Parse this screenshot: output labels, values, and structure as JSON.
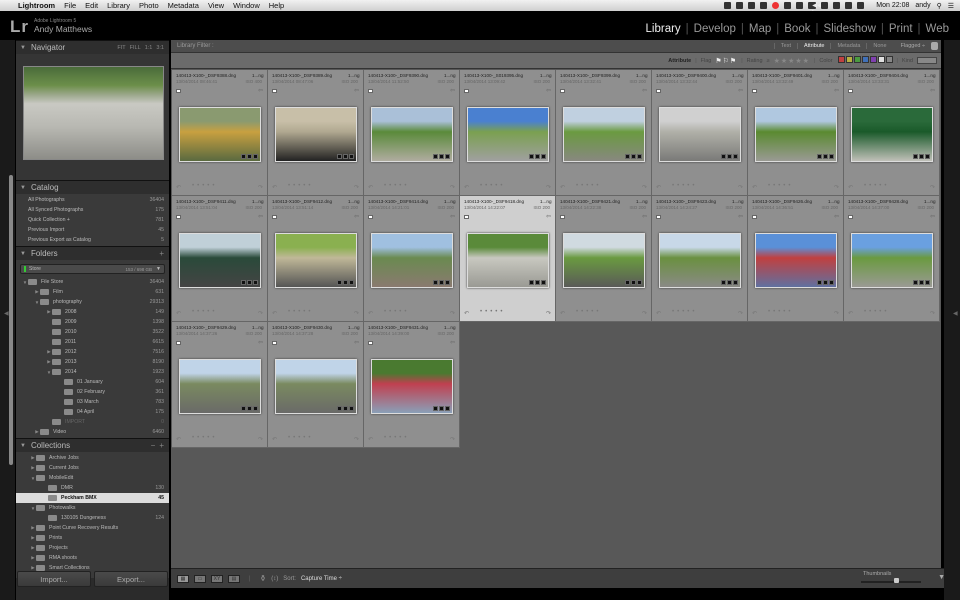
{
  "menubar": {
    "apple": "",
    "app_name": "Lightroom",
    "items": [
      "File",
      "Edit",
      "Library",
      "Photo",
      "Metadata",
      "View",
      "Window",
      "Help"
    ],
    "clock": "Mon 22:08",
    "user": "andy"
  },
  "header": {
    "logo": "Lr",
    "product": "Adobe Lightroom 5",
    "user_name": "Andy Matthews",
    "modules": [
      {
        "label": "Library",
        "active": true
      },
      {
        "label": "Develop"
      },
      {
        "label": "Map"
      },
      {
        "label": "Book"
      },
      {
        "label": "Slideshow"
      },
      {
        "label": "Print"
      },
      {
        "label": "Web"
      }
    ]
  },
  "left": {
    "navigator": {
      "title": "Navigator",
      "zoom_opts": [
        "FIT",
        "FILL",
        "1:1",
        "3:1"
      ]
    },
    "catalog": {
      "title": "Catalog",
      "items": [
        {
          "label": "All Photographs",
          "count": "36404"
        },
        {
          "label": "All Synced Photographs",
          "count": "175"
        },
        {
          "label": "Quick Collection +",
          "count": "781"
        },
        {
          "label": "Previous Import",
          "count": "45"
        },
        {
          "label": "Previous Export as Catalog",
          "count": "5"
        }
      ]
    },
    "folders": {
      "title": "Folders",
      "add": "+",
      "volume": {
        "name": "Store",
        "capacity": "153 / 698 GB"
      },
      "items": [
        {
          "label": "File Store",
          "count": "36404",
          "level": 0,
          "tw": "▼"
        },
        {
          "label": "Film",
          "count": "631",
          "level": 1,
          "tw": "▶"
        },
        {
          "label": "photography",
          "count": "29313",
          "level": 1,
          "tw": "▼"
        },
        {
          "label": "2008",
          "count": "149",
          "level": 2,
          "tw": "▶"
        },
        {
          "label": "2009",
          "count": "1398",
          "level": 2,
          "tw": ""
        },
        {
          "label": "2010",
          "count": "3522",
          "level": 2,
          "tw": ""
        },
        {
          "label": "2011",
          "count": "6615",
          "level": 2,
          "tw": ""
        },
        {
          "label": "2012",
          "count": "7516",
          "level": 2,
          "tw": "▶"
        },
        {
          "label": "2013",
          "count": "8190",
          "level": 2,
          "tw": "▶"
        },
        {
          "label": "2014",
          "count": "1923",
          "level": 2,
          "tw": "▼"
        },
        {
          "label": "01 January",
          "count": "604",
          "level": 3,
          "tw": ""
        },
        {
          "label": "02 February",
          "count": "361",
          "level": 3,
          "tw": ""
        },
        {
          "label": "03 March",
          "count": "783",
          "level": 3,
          "tw": ""
        },
        {
          "label": "04 April",
          "count": "175",
          "level": 3,
          "tw": ""
        },
        {
          "label": "IMPORT",
          "count": "0",
          "level": 2,
          "tw": "",
          "dim": true
        },
        {
          "label": "Video",
          "count": "6460",
          "level": 1,
          "tw": "▶"
        }
      ]
    },
    "collections": {
      "title": "Collections",
      "minus": "−",
      "add": "+",
      "items": [
        {
          "label": "Archive Jobs",
          "count": "",
          "level": 0,
          "tw": "▶"
        },
        {
          "label": "Current Jobs",
          "count": "",
          "level": 0,
          "tw": "▶"
        },
        {
          "label": "MobileEdit",
          "count": "",
          "level": 0,
          "tw": "▼"
        },
        {
          "label": "DMR",
          "count": "130",
          "level": 1,
          "tw": ""
        },
        {
          "label": "Peckham BMX",
          "count": "45",
          "level": 1,
          "tw": "",
          "selected": true
        },
        {
          "label": "Photowalks",
          "count": "",
          "level": 0,
          "tw": "▼"
        },
        {
          "label": "130105 Dungeness",
          "count": "124",
          "level": 1,
          "tw": ""
        },
        {
          "label": "Point Curve Recovery Results",
          "count": "",
          "level": 0,
          "tw": "▶"
        },
        {
          "label": "Prints",
          "count": "",
          "level": 0,
          "tw": "▶"
        },
        {
          "label": "Projects",
          "count": "",
          "level": 0,
          "tw": "▶"
        },
        {
          "label": "RMA shoots",
          "count": "",
          "level": 0,
          "tw": "▶"
        },
        {
          "label": "Smart Collections",
          "count": "",
          "level": 0,
          "tw": "▶"
        }
      ]
    },
    "import_label": "Import...",
    "export_label": "Export..."
  },
  "filter": {
    "title": "Library Filter :",
    "options": [
      "Text",
      "Attribute",
      "Metadata",
      "None"
    ],
    "active": "Attribute",
    "preset": "Flagged ÷",
    "attribute_label": "Attribute",
    "flag_label": "Flag",
    "rating_label": "Rating",
    "rating_op": "≥",
    "color_label": "Color",
    "kind_label": "Kind",
    "colors": [
      "#c04040",
      "#b8b040",
      "#4a9a40",
      "#4070b8",
      "#8040b0",
      "#e0e0e0",
      "#888888"
    ]
  },
  "grid": {
    "cells": [
      {
        "file": "140413-X100-_DSF9388.dng",
        "ext": "1...ng",
        "date": "13/04/2014 08:46:41",
        "iso": "ISO 400",
        "colors": [
          "#8a9a70",
          "#c8a040",
          "#5a6a40"
        ]
      },
      {
        "file": "140413-X100-_DSF9389.dng",
        "ext": "1...ng",
        "date": "13/04/2014 08:47:06",
        "iso": "ISO 200",
        "colors": [
          "#c8bfa8",
          "#b0a890",
          "#222"
        ]
      },
      {
        "file": "140413-X100-_DSF9390.dng",
        "ext": "1...ng",
        "date": "13/04/2014 11:52:50",
        "iso": "ISO 200",
        "colors": [
          "#aac0d8",
          "#5a8a3a",
          "#b0aca0"
        ]
      },
      {
        "file": "140413-X100-_S019395.dng",
        "ext": "1...ng",
        "date": "13/04/2014 13:09:42",
        "iso": "ISO 200",
        "colors": [
          "#4a80d0",
          "#7aa050",
          "#a0a0a0"
        ]
      },
      {
        "file": "140413-X100-_DSF9399.dng",
        "ext": "1...ng",
        "date": "13/04/2014 13:32:41",
        "iso": "ISO 200",
        "colors": [
          "#c0d0e0",
          "#6a9a40",
          "#888880"
        ]
      },
      {
        "file": "140413-X100-_DSF9400.dng",
        "ext": "1...ng",
        "date": "13/04/2014 13:32:44",
        "iso": "ISO 200",
        "colors": [
          "#d0d0d0",
          "#b0b0a8",
          "#7a7a78"
        ]
      },
      {
        "file": "140413-X100-_DSF9401.dng",
        "ext": "1...ng",
        "date": "13/04/2014 13:32:49",
        "iso": "ISO 200",
        "colors": [
          "#b0c8e0",
          "#5a8a30",
          "#9a9a94"
        ]
      },
      {
        "file": "140413-X100-_DSF9404.dng",
        "ext": "1...ng",
        "date": "13/04/2014 13:33:31",
        "iso": "ISO 200",
        "colors": [
          "#2a6a3a",
          "#1a5a2a",
          "#c0c0b8"
        ]
      },
      {
        "file": "140413-X100-_DSF9411.dng",
        "ext": "1...ng",
        "date": "13/04/2014 13:51:04",
        "iso": "ISO 200",
        "colors": [
          "#c0d0d8",
          "#2a4a3a",
          "#444"
        ]
      },
      {
        "file": "140413-X100-_DSF9412.dng",
        "ext": "1...ng",
        "date": "13/04/2014 13:51:14",
        "iso": "ISO 200",
        "colors": [
          "#8ab050",
          "#c0b898",
          "#555"
        ]
      },
      {
        "file": "140413-X100-_DSF9414.dng",
        "ext": "1...ng",
        "date": "13/04/2014 14:21:01",
        "iso": "ISO 200",
        "colors": [
          "#a0c0e0",
          "#6a8a50",
          "#8a7a70"
        ]
      },
      {
        "file": "140413-X100-_DSF9418.dng",
        "ext": "1...ng",
        "date": "13/04/2014 14:22:07",
        "iso": "ISO 200",
        "selected": true,
        "colors": [
          "#5a8a3a",
          "#c8c8c0",
          "#9a9a94"
        ]
      },
      {
        "file": "140413-X100-_DSF9421.dng",
        "ext": "1...ng",
        "date": "13/04/2014 14:22:38",
        "iso": "ISO 200",
        "colors": [
          "#d0dae0",
          "#6a9a40",
          "#5a5a58"
        ]
      },
      {
        "file": "140413-X100-_DSF9423.dng",
        "ext": "1...ng",
        "date": "13/04/2014 14:24:27",
        "iso": "ISO 200",
        "colors": [
          "#c8d8e8",
          "#6a9040",
          "#8a8a86"
        ]
      },
      {
        "file": "140413-X100-_DSF9426.dng",
        "ext": "1...ng",
        "date": "13/04/2014 14:36:51",
        "iso": "ISO 200",
        "colors": [
          "#5a90d8",
          "#c04040",
          "#6070a0"
        ]
      },
      {
        "file": "140413-X100-_DSF9428.dng",
        "ext": "1...ng",
        "date": "13/04/2014 14:37:00",
        "iso": "ISO 200",
        "colors": [
          "#6aa0e0",
          "#6a9a40",
          "#9a9a94"
        ]
      },
      {
        "file": "140413-X100-_DSF9429.dng",
        "ext": "1...ng",
        "date": "13/04/2014 14:37:26",
        "iso": "ISO 200",
        "colors": [
          "#c0d4e8",
          "#7a8a60",
          "#6a6a68"
        ]
      },
      {
        "file": "140413-X100-_DSF9430.dng",
        "ext": "1...ng",
        "date": "13/04/2014 14:37:28",
        "iso": "ISO 200",
        "colors": [
          "#c0d4e8",
          "#7a8a60",
          "#6a6a68"
        ]
      },
      {
        "file": "140413-X100-_DSF9431.dng",
        "ext": "1...ng",
        "date": "13/04/2014 14:39:00",
        "iso": "ISO 200",
        "colors": [
          "#4a7a30",
          "#c04050",
          "#8aa0b8"
        ]
      }
    ]
  },
  "toolbar": {
    "sort_label": "Sort:",
    "sort_value": "Capture Time ÷",
    "thumbnails_label": "Thumbnails",
    "thumbnail_size": 0.6
  }
}
